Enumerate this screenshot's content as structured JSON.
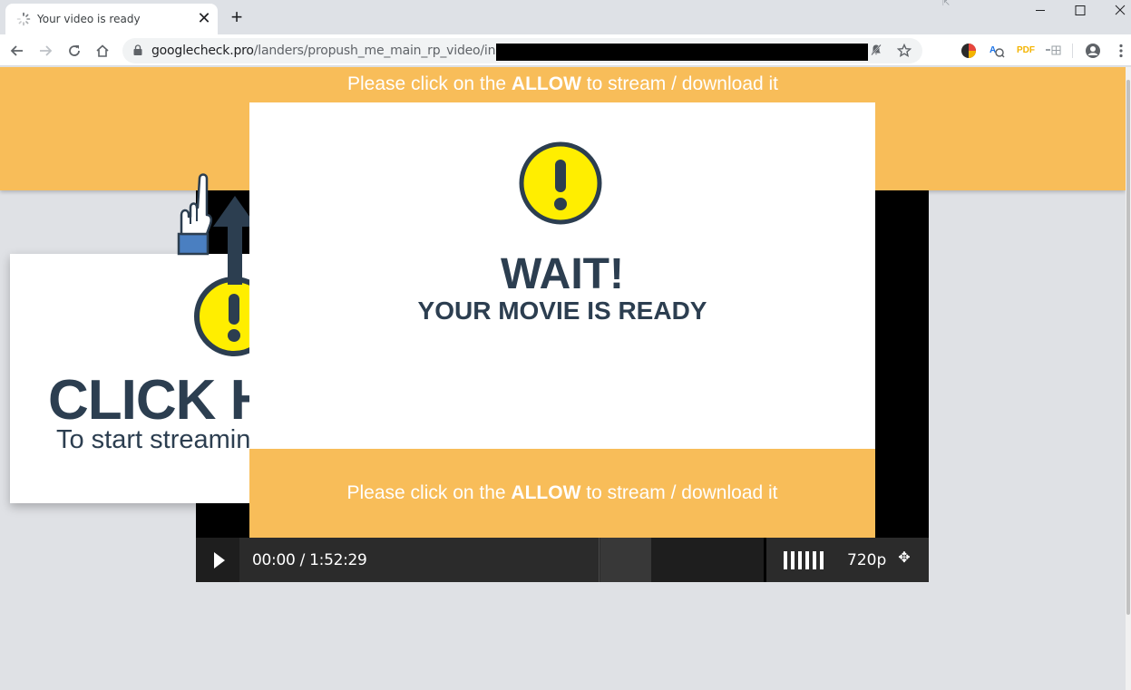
{
  "browser": {
    "tab_title": "Your video is ready",
    "tab_close": "✕",
    "new_tab": "+",
    "url_host": "googlecheck.pro",
    "url_path": "/landers/propush_me_main_rp_video/index.ph",
    "window": {
      "minimize": "—",
      "maximize": "☐",
      "close": "✕"
    },
    "extensions": [
      "PDF"
    ]
  },
  "page": {
    "top_banner": {
      "prefix": "Please click on the ",
      "emphasis": "ALLOW",
      "suffix": " to stream / download it"
    },
    "click_card": {
      "title": "CLICK H",
      "subtitle": "To start streamin"
    },
    "modal": {
      "title": "WAIT!",
      "subtitle": "YOUR MOVIE IS READY",
      "banner": {
        "prefix": "Please click on the ",
        "emphasis": "ALLOW",
        "suffix": " to stream / download it"
      }
    },
    "player": {
      "time": "00:00 / 1:52:29",
      "quality": "720p"
    }
  },
  "colors": {
    "accent_orange": "#f8bd59",
    "warning_yellow": "#ffee00",
    "text_dark": "#2c3e50"
  }
}
